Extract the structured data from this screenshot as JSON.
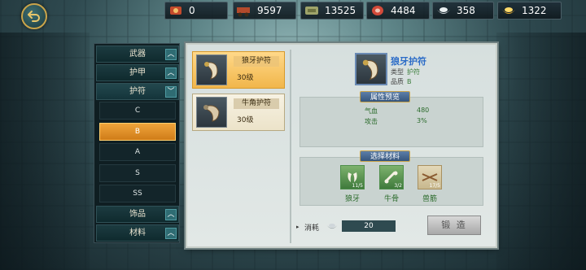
{
  "resources": [
    {
      "icon": "cart-icon",
      "value": "0"
    },
    {
      "icon": "wagon-icon",
      "value": "9597"
    },
    {
      "icon": "scroll-icon",
      "value": "13525"
    },
    {
      "icon": "meat-icon",
      "value": "4484"
    },
    {
      "icon": "silver-ingot-icon",
      "value": "358"
    },
    {
      "icon": "gold-ingot-icon",
      "value": "1322"
    }
  ],
  "menu": {
    "categories": [
      {
        "label": "武器"
      },
      {
        "label": "护甲"
      },
      {
        "label": "护符"
      },
      {
        "label": "饰品"
      },
      {
        "label": "材料"
      }
    ],
    "subs": [
      "C",
      "B",
      "A",
      "S",
      "SS"
    ],
    "active_sub": "B"
  },
  "items": [
    {
      "name": "狼牙护符",
      "level": "30级",
      "selected": true
    },
    {
      "name": "牛角护符",
      "level": "30级",
      "selected": false
    }
  ],
  "detail": {
    "name": "狼牙护符",
    "type_label": "类型",
    "type_value": "护符",
    "quality_label": "品质",
    "quality_value": "B",
    "attr_title": "属性预览",
    "attrs": [
      {
        "key": "气血",
        "value": "480"
      },
      {
        "key": "攻击",
        "value": "3%"
      }
    ],
    "mat_title": "选择材料",
    "materials": [
      {
        "name": "狼牙",
        "count": "11/5"
      },
      {
        "name": "牛骨",
        "count": "3/2"
      },
      {
        "name": "兽筋",
        "count": "17/5"
      }
    ],
    "cost_label": "消耗",
    "cost_value": "20",
    "forge_label": "锻 造"
  }
}
